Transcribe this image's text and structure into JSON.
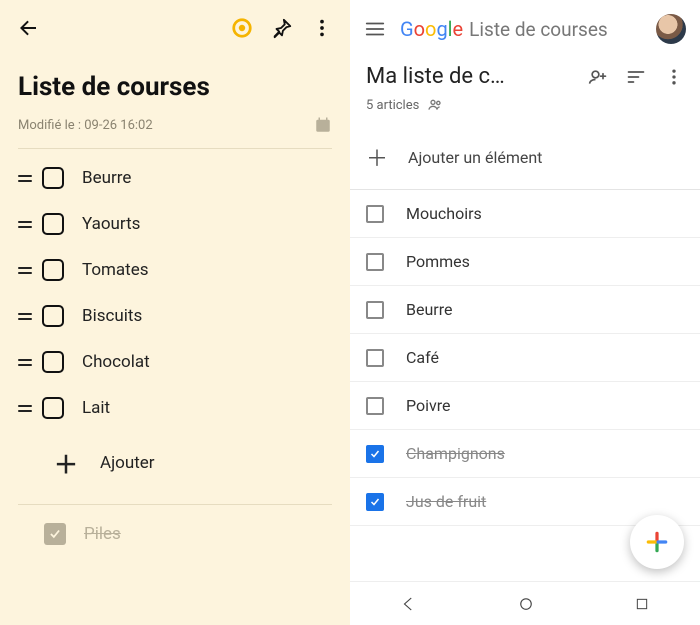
{
  "left": {
    "title": "Liste de courses",
    "modified_prefix": "Modifié le : ",
    "modified_time": "09-26 16:02",
    "add_label": "Ajouter",
    "items": [
      {
        "label": "Beurre"
      },
      {
        "label": "Yaourts"
      },
      {
        "label": "Tomates"
      },
      {
        "label": "Biscuits"
      },
      {
        "label": "Chocolat"
      },
      {
        "label": "Lait"
      }
    ],
    "done": [
      {
        "label": "Piles"
      }
    ]
  },
  "right": {
    "brand": "Google",
    "app_title": "Liste de courses",
    "list_title": "Ma liste de c…",
    "subtitle": "5 articles",
    "add_placeholder": "Ajouter un élément",
    "items": [
      {
        "label": "Mouchoirs",
        "checked": false
      },
      {
        "label": "Pommes",
        "checked": false
      },
      {
        "label": "Beurre",
        "checked": false
      },
      {
        "label": "Café",
        "checked": false
      },
      {
        "label": "Poivre",
        "checked": false
      },
      {
        "label": "Champignons",
        "checked": true
      },
      {
        "label": "Jus de fruit",
        "checked": true
      }
    ]
  },
  "colors": {
    "left_bg": "#fdf4dd",
    "accent_yellow": "#f5b400",
    "google_blue": "#1a73e8"
  }
}
